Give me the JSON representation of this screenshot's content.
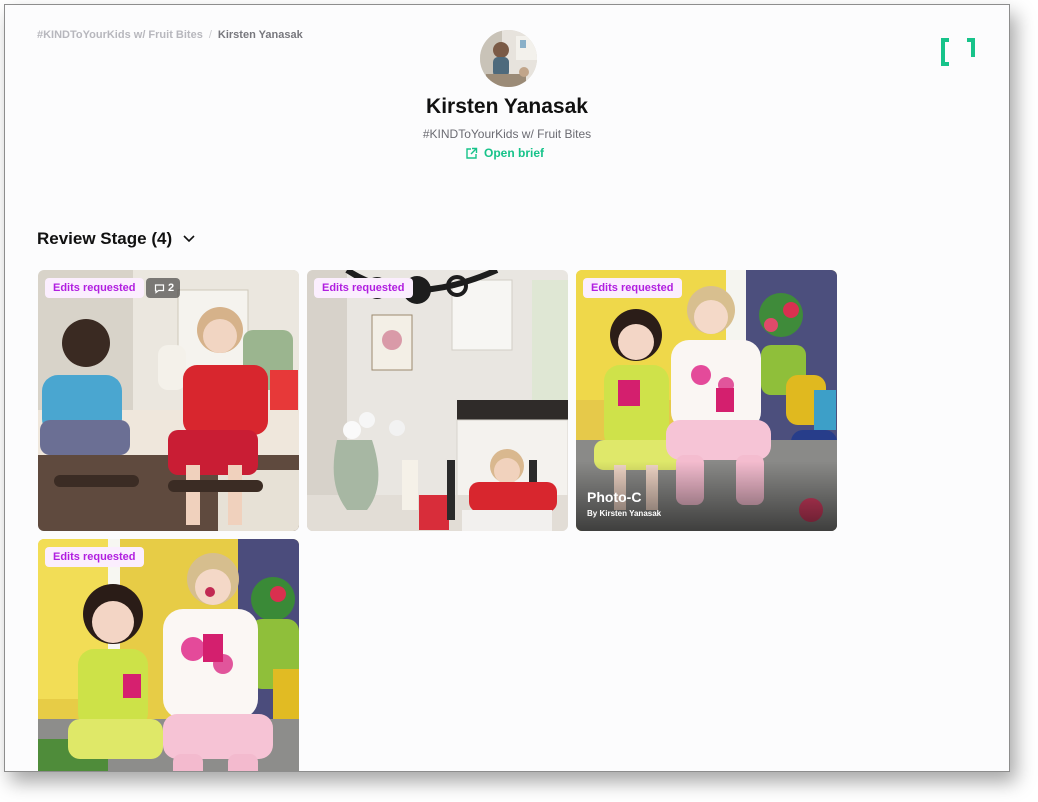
{
  "breadcrumb": {
    "parent": "#KINDToYourKids w/ Fruit Bites",
    "separator": "/",
    "current": "Kirsten Yanasak"
  },
  "profile": {
    "name": "Kirsten Yanasak",
    "campaign": "#KINDToYourKids w/ Fruit Bites",
    "brief_link": "Open brief"
  },
  "stage": {
    "label": "Review Stage (4)"
  },
  "cards": [
    {
      "status": "Edits requested",
      "comments": "2"
    },
    {
      "status": "Edits requested"
    },
    {
      "status": "Edits requested",
      "title": "Photo-C",
      "author": "By Kirsten Yanasak"
    },
    {
      "status": "Edits requested"
    }
  ],
  "colors": {
    "accent": "#17c38a",
    "badge_text": "#b11ee0",
    "badge_bg": "#fbeefe"
  },
  "icons": [
    "logo-bracket-icon",
    "external-link-icon",
    "chevron-down-icon",
    "comment-icon"
  ]
}
